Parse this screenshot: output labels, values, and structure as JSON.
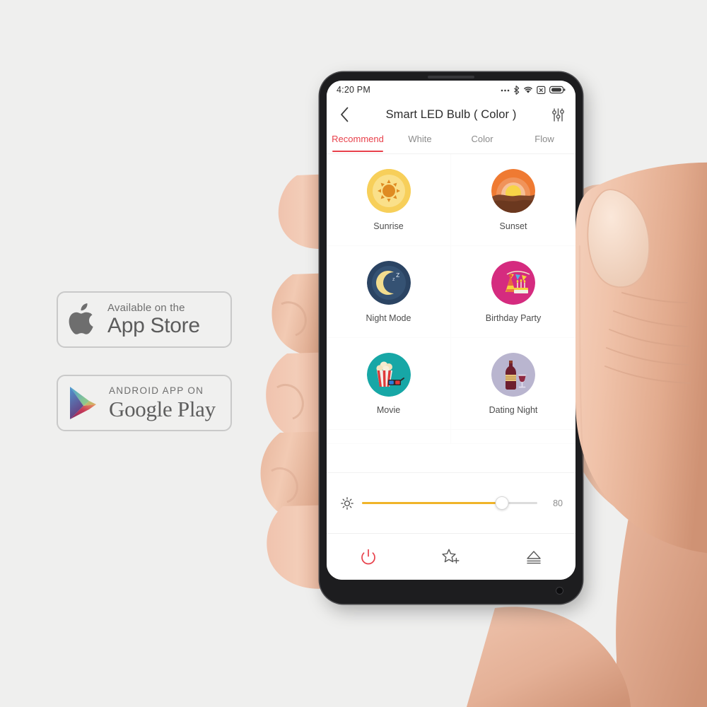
{
  "background_color": "#efefee",
  "badges": [
    {
      "name": "apple-app-store",
      "icon": "apple-logo-icon",
      "small_text": "Available on the",
      "big_text": "App Store"
    },
    {
      "name": "google-play-store",
      "icon": "google-play-triangle-icon",
      "small_text": "ANDROID APP ON",
      "big_text": "Google Play"
    }
  ],
  "phone": {
    "statusbar": {
      "time": "4:20 PM",
      "icons": [
        "more-dots-icon",
        "bluetooth-icon",
        "wifi-icon",
        "vibrate-icon",
        "battery-icon"
      ]
    },
    "appbar": {
      "back_icon": "chevron-left-icon",
      "title": "Smart LED Bulb ( Color )",
      "settings_icon": "sliders-icon"
    },
    "tabs": [
      {
        "label": "Recommend",
        "active": true
      },
      {
        "label": "White",
        "active": false
      },
      {
        "label": "Color",
        "active": false
      },
      {
        "label": "Flow",
        "active": false
      }
    ],
    "scenes": [
      {
        "label": "Sunrise",
        "icon": "sunrise-icon",
        "bg": "#f7cf5a",
        "accent": "#e08b22"
      },
      {
        "label": "Sunset",
        "icon": "sunset-icon",
        "bg": "#ef7a32",
        "accent": "#7d4428"
      },
      {
        "label": "Night Mode",
        "icon": "night-mode-icon",
        "bg": "#2e4a6b",
        "accent": "#f5dd8a"
      },
      {
        "label": "Birthday Party",
        "icon": "birthday-party-icon",
        "bg": "#d52b7f",
        "accent": "#f6d33c"
      },
      {
        "label": "Movie",
        "icon": "movie-icon",
        "bg": "#17a7a6",
        "accent": "#e03b3b"
      },
      {
        "label": "Dating Night",
        "icon": "dating-night-icon",
        "bg": "#b9b5cf",
        "accent": "#6e1f2e"
      },
      {
        "label": "",
        "icon": "partial-orange-icon",
        "bg": "#ef8b2e",
        "accent": "#ef8b2e"
      },
      {
        "label": "",
        "icon": "partial-magenta-icon",
        "bg": "#c12fa3",
        "accent": "#c12fa3"
      }
    ],
    "brightness": {
      "icon": "brightness-sun-icon",
      "value": "80",
      "percent": 80,
      "fill_color": "#f0b429",
      "track_color": "#dcdcdc"
    },
    "bottombar": [
      {
        "name": "power-button",
        "icon": "power-icon",
        "color": "#e8414b"
      },
      {
        "name": "favorite-button",
        "icon": "star-plus-icon",
        "color": "#5a5a5a"
      },
      {
        "name": "share-button",
        "icon": "eject-icon",
        "color": "#5a5a5a"
      }
    ]
  }
}
